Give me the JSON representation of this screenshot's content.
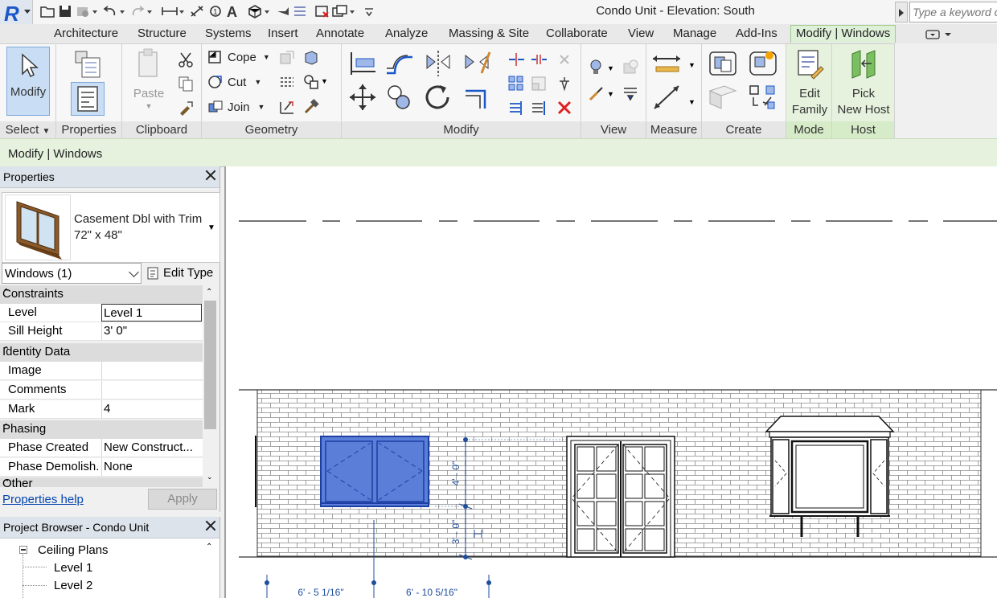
{
  "app": {
    "logo_letter": "R"
  },
  "title": "Condo Unit - Elevation: South",
  "search": {
    "placeholder": "Type a keyword or phrase"
  },
  "tabs": [
    "Architecture",
    "Structure",
    "Systems",
    "Insert",
    "Annotate",
    "Analyze",
    "Massing & Site",
    "Collaborate",
    "View",
    "Manage",
    "Add-Ins",
    "Modify | Windows"
  ],
  "ribbon": {
    "panels": {
      "select": "Select",
      "properties": "Properties",
      "clipboard": "Clipboard",
      "geometry": "Geometry",
      "modify": "Modify",
      "view": "View",
      "measure": "Measure",
      "create": "Create",
      "mode": "Mode",
      "host": "Host"
    },
    "buttons": {
      "modify": "Modify",
      "paste": "Paste",
      "cope": "Cope",
      "cut": "Cut",
      "join": "Join",
      "edit_family_1": "Edit",
      "edit_family_2": "Family",
      "pick_host_1": "Pick",
      "pick_host_2": "New Host"
    }
  },
  "modify_bar": "Modify | Windows",
  "properties": {
    "title": "Properties",
    "type_name_1": "Casement Dbl with Trim",
    "type_name_2": "72\" x 48\"",
    "instance_filter": "Windows (1)",
    "edit_type": "Edit Type",
    "groups": {
      "constraints": "Constraints",
      "identity": "Identity Data",
      "phasing": "Phasing",
      "other": "Other"
    },
    "rows": {
      "level_k": "Level",
      "level_v": "Level 1",
      "sill_k": "Sill Height",
      "sill_v": "3'  0\"",
      "image_k": "Image",
      "image_v": "",
      "comments_k": "Comments",
      "comments_v": "",
      "mark_k": "Mark",
      "mark_v": "4",
      "phase_created_k": "Phase Created",
      "phase_created_v": "New Construct...",
      "phase_demo_k": "Phase Demolish...",
      "phase_demo_v": "None"
    },
    "help": "Properties help",
    "apply": "Apply"
  },
  "browser": {
    "title": "Project Browser - Condo Unit",
    "tree": {
      "ceiling_plans": "Ceiling Plans",
      "level1": "Level 1",
      "level2": "Level 2"
    }
  },
  "dimensions": {
    "vert_top": "4' - 0\"",
    "vert_bottom": "3' - 0\"",
    "horiz_left": "6' - 5 1/16\"",
    "horiz_right": "6' - 10 5/16\""
  },
  "colors": {
    "accent_green": "#e6f2dd",
    "selection_blue": "#5b7fd9",
    "dim_blue": "#1f4e9c"
  }
}
